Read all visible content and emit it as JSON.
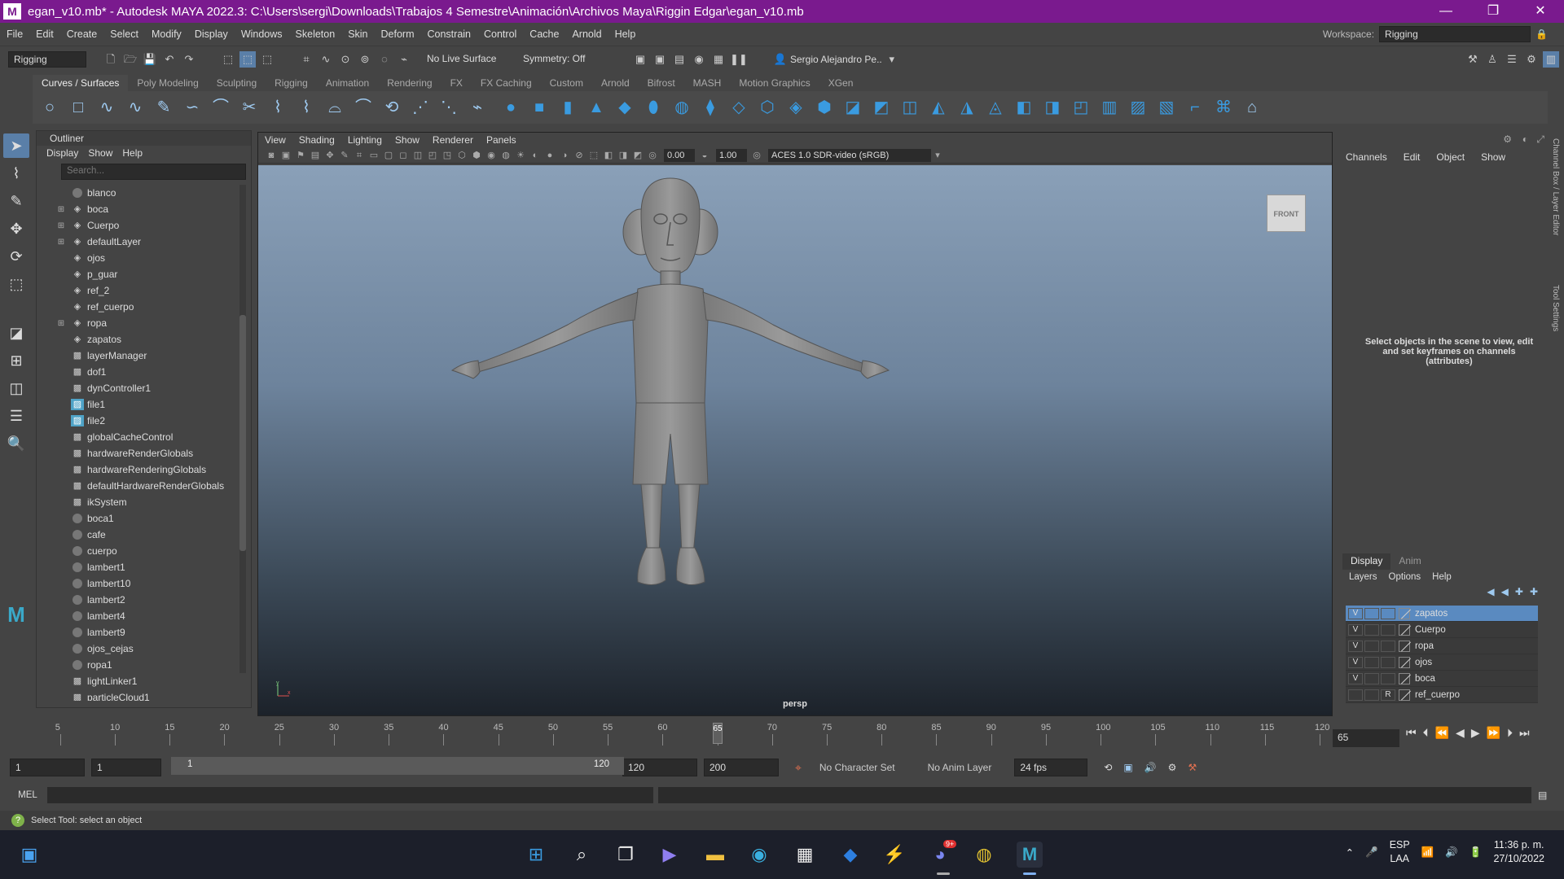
{
  "window": {
    "title": "egan_v10.mb* - Autodesk MAYA 2022.3: C:\\Users\\sergi\\Downloads\\Trabajos 4 Semestre\\Animación\\Archivos Maya\\Riggin Edgar\\egan_v10.mb",
    "app_icon": "M",
    "accent": "#7a1a8e"
  },
  "menubar": [
    "File",
    "Edit",
    "Create",
    "Select",
    "Modify",
    "Display",
    "Windows",
    "Skeleton",
    "Skin",
    "Deform",
    "Constrain",
    "Control",
    "Cache",
    "Arnold",
    "Help"
  ],
  "workspace": {
    "label": "Workspace:",
    "value": "Rigging"
  },
  "statusline": {
    "menuset": "Rigging",
    "live_surface": "No Live Surface",
    "symmetry": "Symmetry: Off",
    "user": "Sergio Alejandro Pe.."
  },
  "shelf": {
    "tabs": [
      "Curves / Surfaces",
      "Poly Modeling",
      "Sculpting",
      "Rigging",
      "Animation",
      "Rendering",
      "FX",
      "FX Caching",
      "Custom",
      "Arnold",
      "Bifrost",
      "MASH",
      "Motion Graphics",
      "XGen"
    ],
    "active_tab": "Curves / Surfaces"
  },
  "outliner": {
    "title": "Outliner",
    "menu": [
      "Display",
      "Show",
      "Help"
    ],
    "search_placeholder": "Search...",
    "items": [
      {
        "label": "blanco",
        "icon": "sphere",
        "expand": ""
      },
      {
        "label": "boca",
        "icon": "layer",
        "expand": "⊞"
      },
      {
        "label": "Cuerpo",
        "icon": "layer",
        "expand": "⊞"
      },
      {
        "label": "defaultLayer",
        "icon": "layer",
        "expand": "⊞"
      },
      {
        "label": "ojos",
        "icon": "layer",
        "expand": ""
      },
      {
        "label": "p_guar",
        "icon": "layer",
        "expand": ""
      },
      {
        "label": "ref_2",
        "icon": "layer",
        "expand": ""
      },
      {
        "label": "ref_cuerpo",
        "icon": "layer",
        "expand": ""
      },
      {
        "label": "ropa",
        "icon": "layer",
        "expand": "⊞"
      },
      {
        "label": "zapatos",
        "icon": "layer",
        "expand": ""
      },
      {
        "label": "layerManager",
        "icon": "node",
        "expand": ""
      },
      {
        "label": "dof1",
        "icon": "node",
        "expand": ""
      },
      {
        "label": "dynController1",
        "icon": "node",
        "expand": ""
      },
      {
        "label": "file1",
        "icon": "file",
        "expand": ""
      },
      {
        "label": "file2",
        "icon": "file",
        "expand": ""
      },
      {
        "label": "globalCacheControl",
        "icon": "node",
        "expand": ""
      },
      {
        "label": "hardwareRenderGlobals",
        "icon": "node",
        "expand": ""
      },
      {
        "label": "hardwareRenderingGlobals",
        "icon": "node",
        "expand": ""
      },
      {
        "label": "defaultHardwareRenderGlobals",
        "icon": "node",
        "expand": ""
      },
      {
        "label": "ikSystem",
        "icon": "node",
        "expand": ""
      },
      {
        "label": "boca1",
        "icon": "sphere",
        "expand": ""
      },
      {
        "label": "cafe",
        "icon": "sphere",
        "expand": ""
      },
      {
        "label": "cuerpo",
        "icon": "sphere",
        "expand": ""
      },
      {
        "label": "lambert1",
        "icon": "sphere",
        "expand": ""
      },
      {
        "label": "lambert10",
        "icon": "sphere",
        "expand": ""
      },
      {
        "label": "lambert2",
        "icon": "sphere",
        "expand": ""
      },
      {
        "label": "lambert4",
        "icon": "sphere",
        "expand": ""
      },
      {
        "label": "lambert9",
        "icon": "sphere",
        "expand": ""
      },
      {
        "label": "ojos_cejas",
        "icon": "sphere",
        "expand": ""
      },
      {
        "label": "ropa1",
        "icon": "sphere",
        "expand": ""
      },
      {
        "label": "lightLinker1",
        "icon": "node",
        "expand": ""
      },
      {
        "label": "particleCloud1",
        "icon": "node",
        "expand": ""
      }
    ]
  },
  "viewport": {
    "menu": [
      "View",
      "Shading",
      "Lighting",
      "Show",
      "Renderer",
      "Panels"
    ],
    "exposure": "0.00",
    "gamma": "1.00",
    "color_management": "ACES 1.0 SDR-video (sRGB)",
    "viewcube_label": "FRONT",
    "camera": "persp",
    "axis_y": "y",
    "axis_x": "x"
  },
  "channelbox": {
    "menu": [
      "Channels",
      "Edit",
      "Object",
      "Show"
    ],
    "message": "Select objects in the scene to view, edit and set keyframes on channels (attributes)",
    "side_tabs": [
      "Channel Box / Layer Editor",
      "Tool Settings"
    ]
  },
  "layer_editor": {
    "tabs": [
      "Display",
      "Anim"
    ],
    "menu": [
      "Layers",
      "Options",
      "Help"
    ],
    "layers": [
      {
        "name": "zapatos",
        "v": "V",
        "r": "",
        "selected": true
      },
      {
        "name": "Cuerpo",
        "v": "V",
        "r": "",
        "selected": false
      },
      {
        "name": "ropa",
        "v": "V",
        "r": "",
        "selected": false
      },
      {
        "name": "ojos",
        "v": "V",
        "r": "",
        "selected": false
      },
      {
        "name": "boca",
        "v": "V",
        "r": "",
        "selected": false
      },
      {
        "name": "ref_cuerpo",
        "v": "",
        "r": "R",
        "selected": false
      }
    ]
  },
  "timeline": {
    "ticks": [
      "5",
      "10",
      "15",
      "20",
      "25",
      "30",
      "35",
      "40",
      "45",
      "50",
      "55",
      "60",
      "65",
      "70",
      "75",
      "80",
      "85",
      "90",
      "95",
      "100",
      "105",
      "110",
      "115",
      "120"
    ],
    "current_frame": "65",
    "current_marker": "65"
  },
  "range": {
    "start": "1",
    "playback_start": "1",
    "slider_start": "1",
    "slider_end": "120",
    "playback_end": "120",
    "end": "200",
    "character_set": "No Character Set",
    "anim_layer": "No Anim Layer",
    "fps": "24 fps"
  },
  "command_line": {
    "label": "MEL"
  },
  "help_line": {
    "text": "Select Tool: select an object"
  },
  "taskbar": {
    "lang_top": "ESP",
    "lang_bottom": "LAA",
    "time": "11:36 p. m.",
    "date": "27/10/2022",
    "discord_badge": "9+"
  }
}
